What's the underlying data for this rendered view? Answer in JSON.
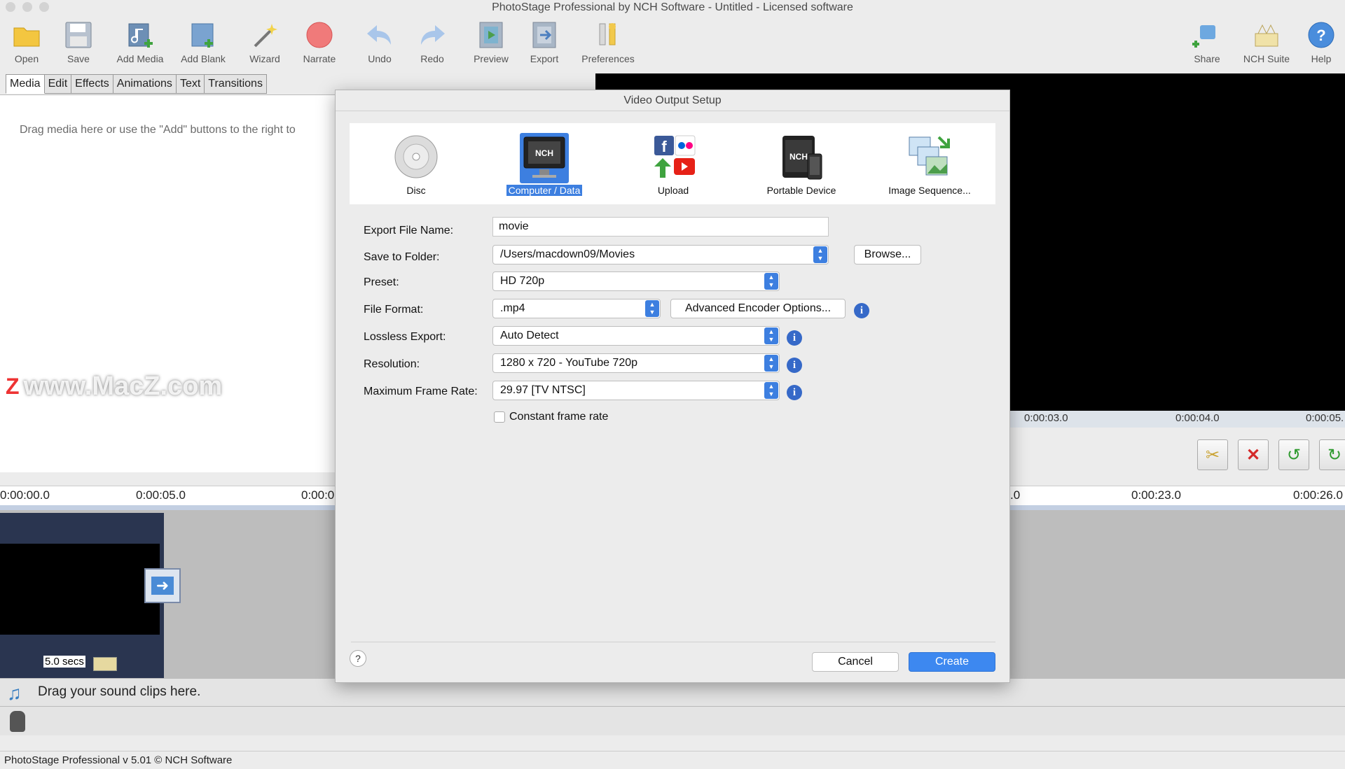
{
  "window": {
    "title": "PhotoStage Professional by NCH Software - Untitled - Licensed software"
  },
  "toolbar": {
    "open": "Open",
    "save": "Save",
    "add_media": "Add Media",
    "add_blank": "Add Blank",
    "wizard": "Wizard",
    "narrate": "Narrate",
    "undo": "Undo",
    "redo": "Redo",
    "preview": "Preview",
    "export": "Export",
    "preferences": "Preferences",
    "share": "Share",
    "nch_suite": "NCH Suite",
    "help": "Help"
  },
  "tabs": [
    "Media",
    "Edit",
    "Effects",
    "Animations",
    "Text",
    "Transitions"
  ],
  "media": {
    "hint": "Drag media here or use the \"Add\" buttons to the right to"
  },
  "watermark": {
    "z": "Z",
    "text": "www.MacZ.com"
  },
  "preview": {
    "ruler": [
      "0:00:03.0",
      "0:00:04.0",
      "0:00:05."
    ]
  },
  "timeline": {
    "ruler": [
      "0:00:00.0",
      "0:00:05.0",
      "0:00:0",
      ".0",
      "0:00:23.0",
      "0:00:26.0"
    ],
    "clip_duration": "5.0 secs",
    "sound_hint": "Drag your sound clips here."
  },
  "status": {
    "text": "PhotoStage Professional v 5.01 © NCH Software"
  },
  "dialog": {
    "title": "Video Output Setup",
    "destinations": [
      "Disc",
      "Computer / Data",
      "Upload",
      "Portable Device",
      "Image Sequence..."
    ],
    "selected_destination": "Computer / Data",
    "labels": {
      "file_name": "Export File Name:",
      "folder": "Save to Folder:",
      "preset": "Preset:",
      "format": "File Format:",
      "lossless": "Lossless Export:",
      "resolution": "Resolution:",
      "frame_rate": "Maximum Frame Rate:"
    },
    "values": {
      "file_name": "movie",
      "folder": "/Users/macdown09/Movies",
      "preset": "HD 720p",
      "format": ".mp4",
      "lossless": "Auto Detect",
      "resolution": "1280 x 720 - YouTube 720p",
      "frame_rate": "29.97 [TV NTSC]"
    },
    "constant_frame_rate": {
      "label": "Constant frame rate",
      "checked": false
    },
    "buttons": {
      "browse": "Browse...",
      "advanced": "Advanced Encoder Options...",
      "cancel": "Cancel",
      "create": "Create",
      "help": "?"
    },
    "info_glyph": "i"
  },
  "colors": {
    "accent": "#3d88f0",
    "selection": "#3d7fe0",
    "preview_bg": "#000000"
  }
}
